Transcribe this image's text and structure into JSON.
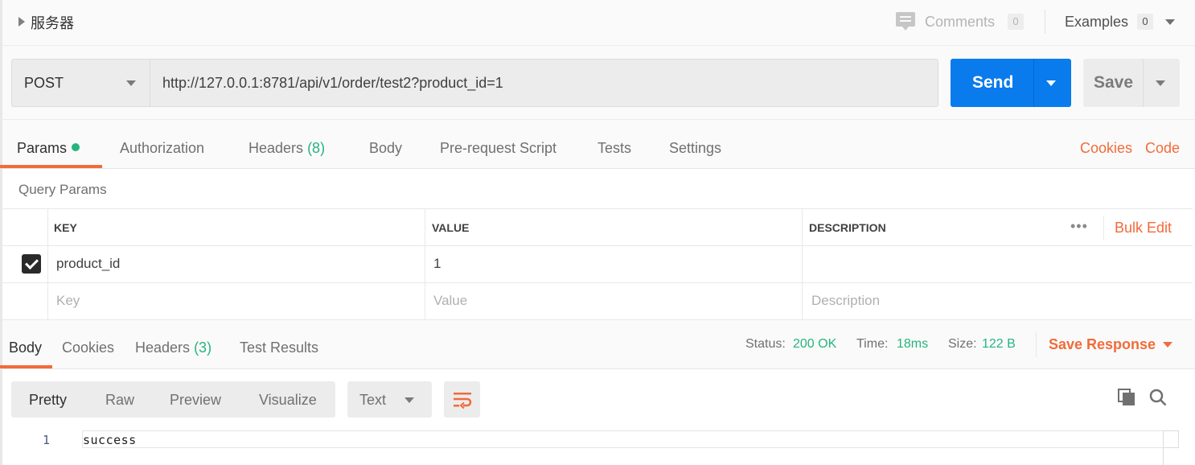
{
  "header": {
    "request_name": "服务器",
    "comments_label": "Comments",
    "comments_count": "0",
    "examples_label": "Examples",
    "examples_count": "0"
  },
  "request": {
    "method": "POST",
    "url": "http://127.0.0.1:8781/api/v1/order/test2?product_id=1",
    "send_label": "Send",
    "save_label": "Save"
  },
  "request_tabs": [
    {
      "label": "Params",
      "active": true
    },
    {
      "label": "Authorization"
    },
    {
      "label": "Headers",
      "count": "(8)"
    },
    {
      "label": "Body"
    },
    {
      "label": "Pre-request Script"
    },
    {
      "label": "Tests"
    },
    {
      "label": "Settings"
    }
  ],
  "request_links": {
    "cookies": "Cookies",
    "code": "Code"
  },
  "params": {
    "title": "Query Params",
    "columns": [
      "KEY",
      "VALUE",
      "DESCRIPTION"
    ],
    "more_label": "•••",
    "bulk_edit_label": "Bulk Edit",
    "rows": [
      {
        "checked": true,
        "key": "product_id",
        "value": "1",
        "description": ""
      }
    ],
    "placeholders": {
      "key": "Key",
      "value": "Value",
      "description": "Description"
    }
  },
  "response_tabs": [
    {
      "label": "Body",
      "active": true
    },
    {
      "label": "Cookies"
    },
    {
      "label": "Headers",
      "count": "(3)"
    },
    {
      "label": "Test Results"
    }
  ],
  "response_meta": {
    "status_label": "Status:",
    "status_value": "200 OK",
    "time_label": "Time:",
    "time_value": "18ms",
    "size_label": "Size:",
    "size_value": "122 B",
    "save_response_label": "Save Response"
  },
  "body_toolbar": {
    "modes": [
      "Pretty",
      "Raw",
      "Preview",
      "Visualize"
    ],
    "active_mode": "Pretty",
    "format": "Text",
    "icons": [
      "wrap-lines-icon",
      "copy-icon",
      "search-icon"
    ]
  },
  "response_body": {
    "lines": [
      {
        "number": "1",
        "text": "success"
      }
    ]
  },
  "colors": {
    "accent_orange": "#f26b3a",
    "send_blue": "#097bed",
    "success_green": "#26b47f"
  }
}
